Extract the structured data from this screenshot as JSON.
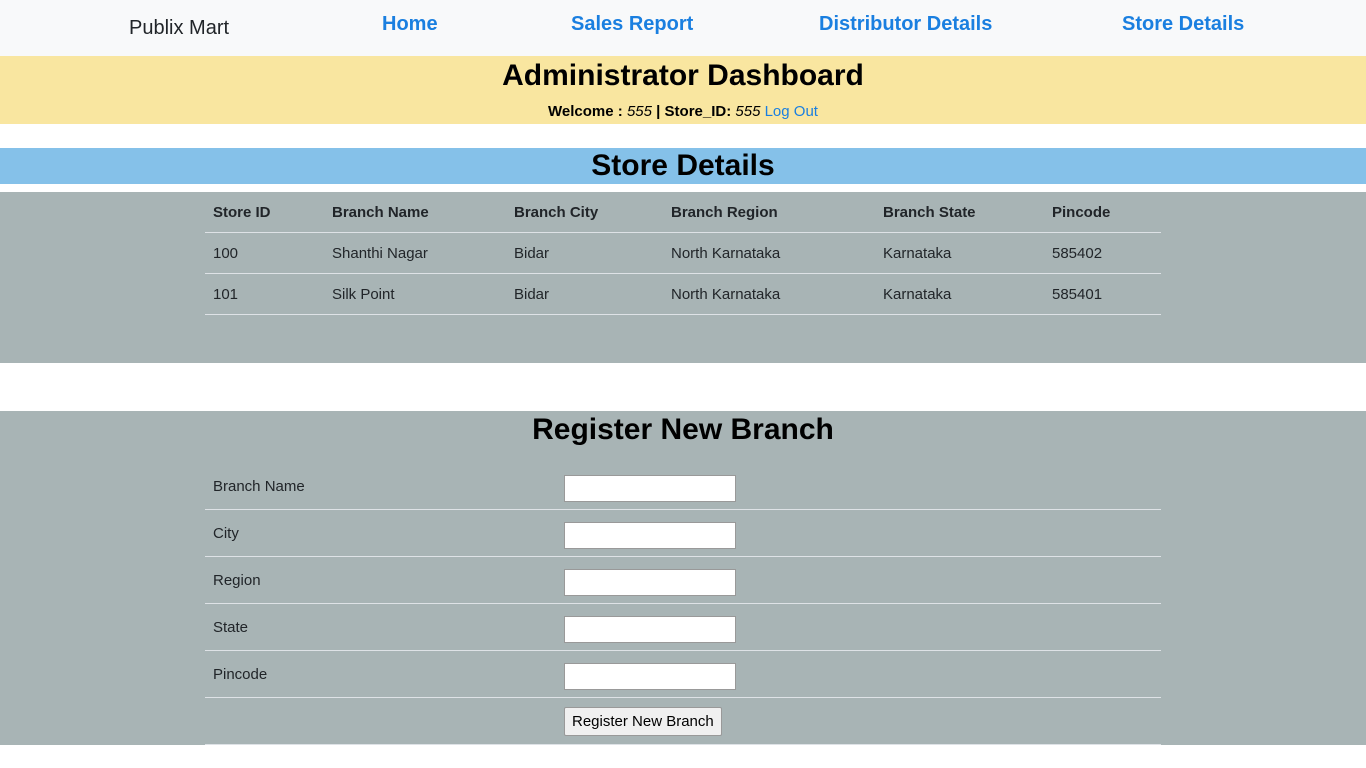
{
  "navbar": {
    "brand": "Publix Mart",
    "links": [
      {
        "label": "Home"
      },
      {
        "label": "Sales Report"
      },
      {
        "label": "Distributor Details"
      },
      {
        "label": "Store Details"
      }
    ]
  },
  "dashboard": {
    "title": "Administrator Dashboard",
    "welcome_label": "Welcome :",
    "welcome_value": "555",
    "separator": "|",
    "store_label": "Store_ID:",
    "store_value": "555",
    "logout_label": "Log Out"
  },
  "store_details": {
    "title": "Store Details",
    "columns": [
      "Store ID",
      "Branch Name",
      "Branch City",
      "Branch Region",
      "Branch State",
      "Pincode"
    ],
    "rows": [
      [
        "100",
        "Shanthi Nagar",
        "Bidar",
        "North Karnataka",
        "Karnataka",
        "585402"
      ],
      [
        "101",
        "Silk Point",
        "Bidar",
        "North Karnataka",
        "Karnataka",
        "585401"
      ]
    ]
  },
  "register_form": {
    "title": "Register New Branch",
    "fields": [
      {
        "label": "Branch Name",
        "value": ""
      },
      {
        "label": "City",
        "value": ""
      },
      {
        "label": "Region",
        "value": ""
      },
      {
        "label": "State",
        "value": ""
      },
      {
        "label": "Pincode",
        "value": ""
      }
    ],
    "submit_label": "Register New Branch"
  },
  "colors": {
    "navbar_bg": "#f8f9fa",
    "link": "#1a7fe0",
    "dashboard_bg": "#f9e6a0",
    "section_title_bg": "#85c1e9",
    "panel_bg": "#a8b4b5"
  }
}
